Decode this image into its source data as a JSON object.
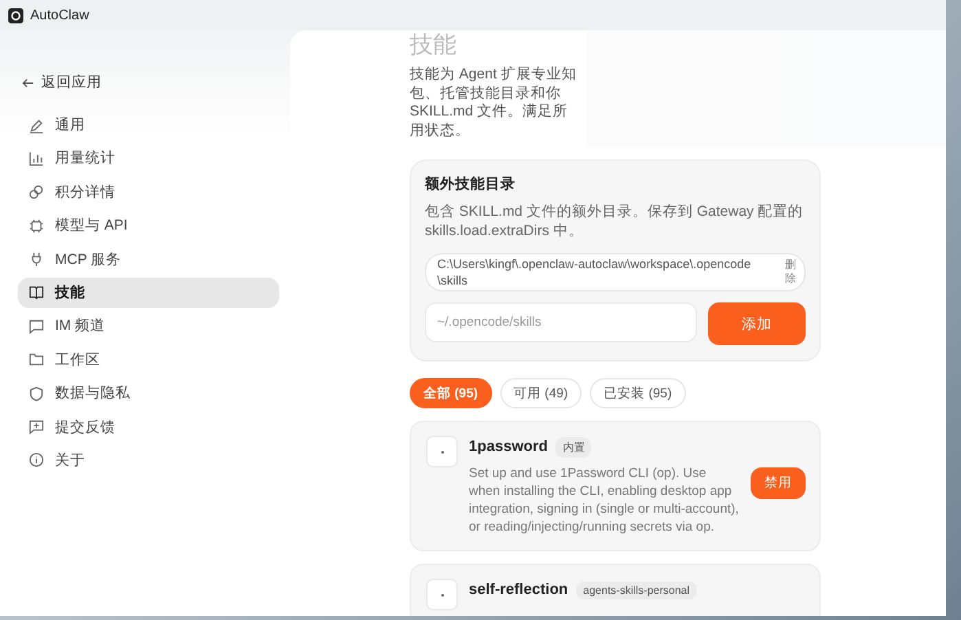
{
  "window": {
    "title": "AutoClaw"
  },
  "sidebar": {
    "back": "返回应用",
    "items": [
      {
        "label": "通用",
        "selected": false
      },
      {
        "label": "用量统计",
        "selected": false
      },
      {
        "label": "积分详情",
        "selected": false
      },
      {
        "label": "模型与 API",
        "selected": false
      },
      {
        "label": "MCP 服务",
        "selected": false
      },
      {
        "label": "技能",
        "selected": true
      },
      {
        "label": "IM 频道",
        "selected": false
      },
      {
        "label": "工作区",
        "selected": false
      },
      {
        "label": "数据与隐私",
        "selected": false
      },
      {
        "label": "提交反馈",
        "selected": false
      },
      {
        "label": "关于",
        "selected": false
      }
    ]
  },
  "page": {
    "title": "技能",
    "description_lines": [
      "技能为 Agent 扩展专业知",
      "包、托管技能目录和你",
      "SKILL.md 文件。满足所",
      "用状态。"
    ]
  },
  "extra_dirs": {
    "title": "额外技能目录",
    "description": "包含 SKILL.md 文件的额外目录。保存到 Gateway 配置的 skills.load.extraDirs 中。",
    "paths": [
      {
        "path": "C:\\Users\\kingf\\.openclaw-autoclaw\\workspace\\.opencode\\skills",
        "remove": "删除"
      }
    ],
    "input": {
      "placeholder": "~/.opencode/skills"
    },
    "add_button": "添加"
  },
  "filters": [
    {
      "label": "全部 (95)",
      "selected": true
    },
    {
      "label": "可用 (49)",
      "selected": false
    },
    {
      "label": "已安装 (95)",
      "selected": false
    }
  ],
  "skills": [
    {
      "name": "1password",
      "tag": "内置",
      "description": "Set up and use 1Password CLI (op). Use when installing the CLI, enabling desktop app integration, signing in (single or multi-account), or reading/injecting/running secrets via op.",
      "button": "禁用"
    },
    {
      "name": "self-reflection",
      "tag": "agents-skills-personal"
    }
  ]
}
